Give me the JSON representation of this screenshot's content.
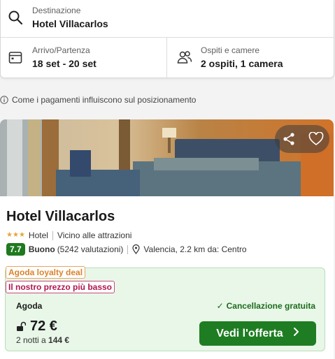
{
  "search": {
    "destination_label": "Destinazione",
    "destination_value": "Hotel Villacarlos",
    "dates_label": "Arrivo/Partenza",
    "dates_value": "18 set - 20 set",
    "guests_label": "Ospiti e camere",
    "guests_value": "2 ospiti, 1 camera"
  },
  "info_note": "Come i pagamenti influiscono sul posizionamento",
  "hotel": {
    "name": "Hotel Villacarlos",
    "stars": 3,
    "type": "Hotel",
    "highlight": "Vicino alle attrazioni",
    "score": "7.7",
    "score_word": "Buono",
    "reviews": "(5242 valutazioni)",
    "location": "Valencia, 2.2 km da: Centro"
  },
  "deal": {
    "tag_loyalty": "Agoda loyalty deal",
    "tag_price": "Il nostro prezzo più basso",
    "provider": "Agoda",
    "cancellation": "Cancellazione gratuita",
    "price": "72 €",
    "nights_prefix": "2 notti a",
    "total": "144 €",
    "cta_label": "Vedi l'offerta"
  },
  "colors": {
    "accent_green": "#1e7d22",
    "score_green": "#1f7a1f",
    "loyalty_orange": "#d9822b",
    "price_tag_red": "#b0164e",
    "deal_bg": "#e8f7e8"
  },
  "icons": {
    "destination": "search-icon",
    "dates": "calendar-icon",
    "guests": "users-icon",
    "info": "info-icon",
    "share": "share-icon",
    "favorite": "heart-icon",
    "location": "pin-icon",
    "lock": "lock-icon",
    "cta": "chevron-right-icon"
  }
}
